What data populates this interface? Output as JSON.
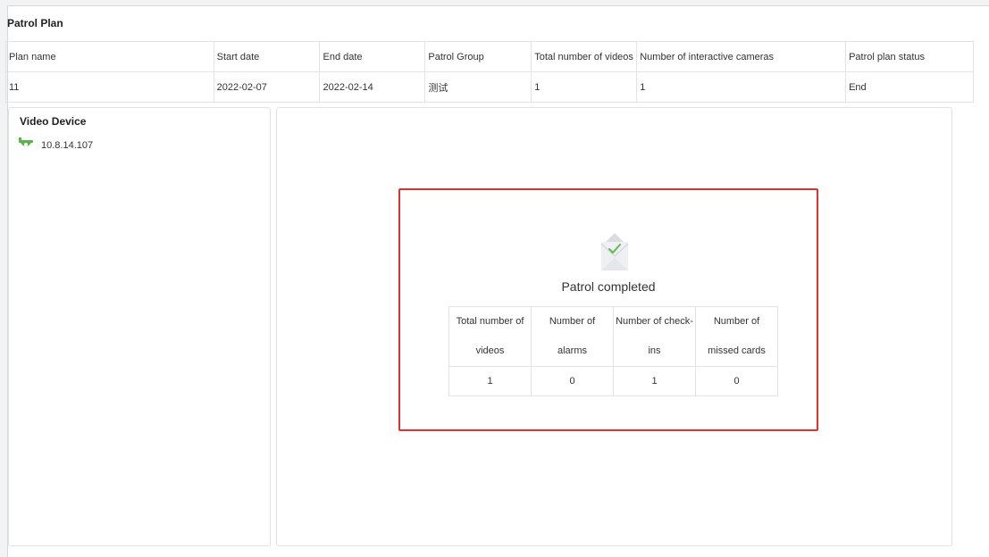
{
  "page": {
    "title": "Patrol Plan"
  },
  "plan_table": {
    "headers": [
      "Plan name",
      "Start date",
      "End date",
      "Patrol Group",
      "Total number of videos",
      "Number of interactive cameras",
      "Patrol plan status"
    ],
    "rows": [
      [
        "11",
        "2022-02-07",
        "2022-02-14",
        "测试",
        "1",
        "1",
        "End"
      ]
    ]
  },
  "device_panel": {
    "title": "Video Device",
    "items": [
      {
        "ip": "10.8.14.107",
        "icon": "camera-icon"
      }
    ]
  },
  "result": {
    "icon": "envelope-check-icon",
    "title": "Patrol completed",
    "headers": [
      "Total number of videos",
      "Number of alarms",
      "Number of check-ins",
      "Number of missed cards"
    ],
    "values": [
      "1",
      "0",
      "1",
      "0"
    ]
  },
  "colors": {
    "highlight_border": "#e0312d",
    "check_green": "#5bbf4a",
    "camera_green": "#59b34a"
  }
}
